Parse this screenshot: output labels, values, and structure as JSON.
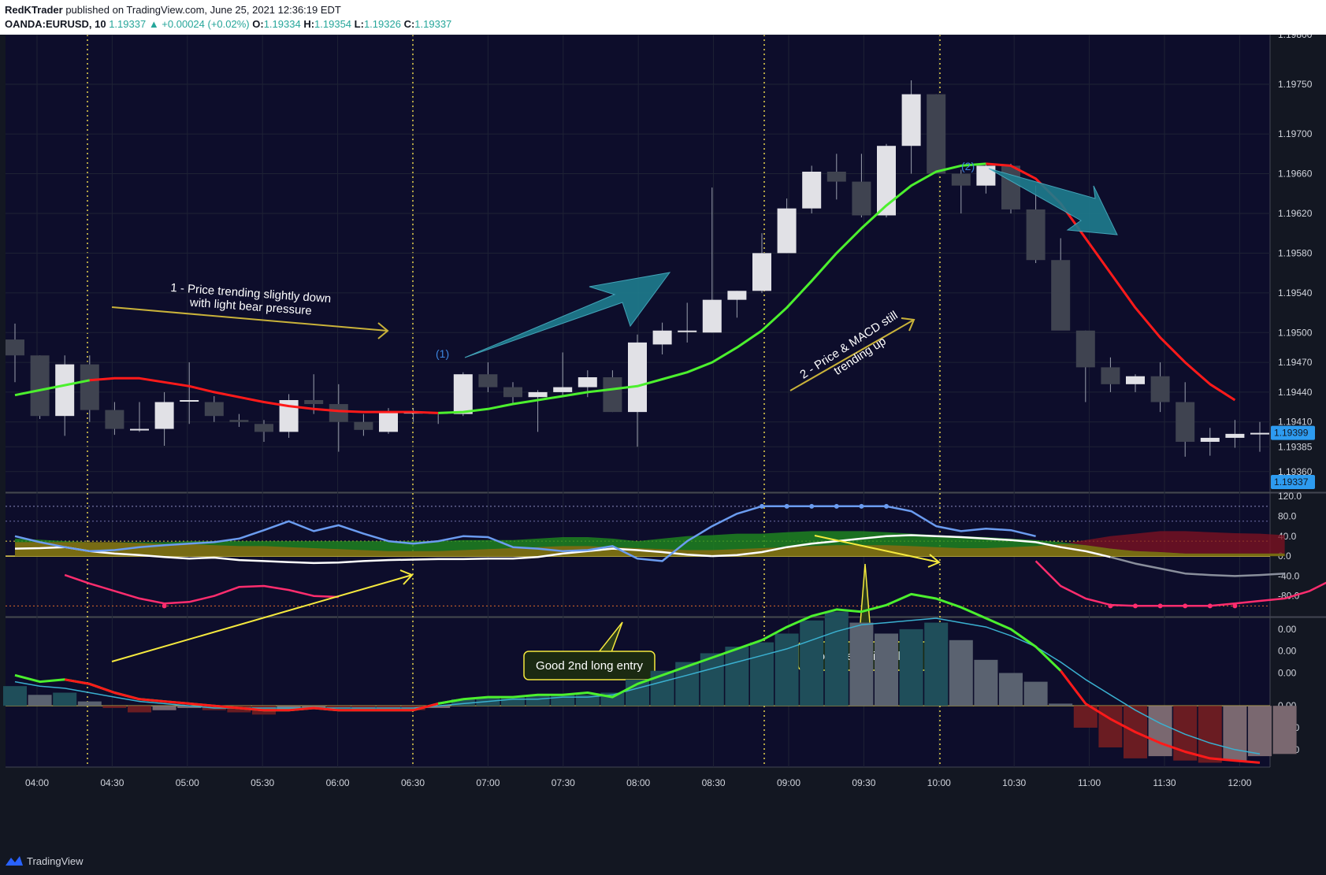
{
  "header": {
    "author": "RedKTrader",
    "published_text": " published on TradingView.com, June 25, 2021 12:36:19 EDT",
    "symbol": "OANDA:EURUSD, 10",
    "last": "1.19337",
    "change": "▲ +0.00024 (+0.02%)",
    "o_label": "O:",
    "o_val": "1.19334",
    "h_label": "H:",
    "h_val": "1.19354",
    "l_label": "L:",
    "l_val": "1.19326",
    "c_label": "C:",
    "c_val": "1.19337"
  },
  "footer": {
    "brand": "TradingView",
    "logo_icon": "tradingview-logo-icon"
  },
  "colors": {
    "background": "#131722",
    "panel_bg": "#0d0d2b",
    "up_candle": "#e1e1e6",
    "down_candle": "#3f4350",
    "ma_up": "#4cf02e",
    "ma_down": "#ff1a1a",
    "macd_blue": "#6b9cf0",
    "macd_pink": "#ff2d6e",
    "macd_white": "#ffffff",
    "annot_yellow": "#f5e93e",
    "arrow_teal": "#1e7c8e",
    "price_badge": "#2d9bf0"
  },
  "chart_data": [
    {
      "type": "candlestick",
      "panel": "price",
      "x_ticks": [
        "04:00",
        "04:30",
        "05:00",
        "05:30",
        "06:00",
        "06:30",
        "07:00",
        "07:30",
        "08:00",
        "08:30",
        "09:00",
        "09:30",
        "10:00",
        "10:30",
        "11:00",
        "11:30",
        "12:00"
      ],
      "y_ticks": [
        "1.19800",
        "1.19750",
        "1.19700",
        "1.19660",
        "1.19620",
        "1.19580",
        "1.19540",
        "1.19500",
        "1.19470",
        "1.19440",
        "1.19410",
        "1.19385",
        "1.19360"
      ],
      "ylim": [
        1.1934,
        1.198
      ],
      "price_badges": [
        "1.19399",
        "1.19337"
      ],
      "candles": [
        {
          "o": 1.19493,
          "h": 1.19509,
          "l": 1.1945,
          "c": 1.19477
        },
        {
          "o": 1.19477,
          "h": 1.19477,
          "l": 1.19413,
          "c": 1.19416
        },
        {
          "o": 1.19416,
          "h": 1.19477,
          "l": 1.19396,
          "c": 1.19468
        },
        {
          "o": 1.19468,
          "h": 1.19477,
          "l": 1.1941,
          "c": 1.19422
        },
        {
          "o": 1.19422,
          "h": 1.1943,
          "l": 1.19397,
          "c": 1.19403
        },
        {
          "o": 1.19403,
          "h": 1.1943,
          "l": 1.194,
          "c": 1.19403
        },
        {
          "o": 1.19403,
          "h": 1.1944,
          "l": 1.19386,
          "c": 1.1943
        },
        {
          "o": 1.19432,
          "h": 1.1947,
          "l": 1.19408,
          "c": 1.19432
        },
        {
          "o": 1.1943,
          "h": 1.19436,
          "l": 1.1941,
          "c": 1.19416
        },
        {
          "o": 1.19412,
          "h": 1.19418,
          "l": 1.19405,
          "c": 1.1941
        },
        {
          "o": 1.19408,
          "h": 1.19412,
          "l": 1.1939,
          "c": 1.194
        },
        {
          "o": 1.194,
          "h": 1.19438,
          "l": 1.19394,
          "c": 1.19432
        },
        {
          "o": 1.19432,
          "h": 1.19458,
          "l": 1.19418,
          "c": 1.19428
        },
        {
          "o": 1.19428,
          "h": 1.19448,
          "l": 1.1938,
          "c": 1.1941
        },
        {
          "o": 1.1941,
          "h": 1.19418,
          "l": 1.19396,
          "c": 1.19402
        },
        {
          "o": 1.194,
          "h": 1.19424,
          "l": 1.19398,
          "c": 1.1942
        },
        {
          "o": 1.1942,
          "h": 1.19424,
          "l": 1.1941,
          "c": 1.1942
        },
        {
          "o": 1.1942,
          "h": 1.1942,
          "l": 1.19408,
          "c": 1.19418
        },
        {
          "o": 1.19418,
          "h": 1.1946,
          "l": 1.19416,
          "c": 1.19458
        },
        {
          "o": 1.19458,
          "h": 1.1947,
          "l": 1.1944,
          "c": 1.19445
        },
        {
          "o": 1.19445,
          "h": 1.1945,
          "l": 1.19428,
          "c": 1.19435
        },
        {
          "o": 1.19435,
          "h": 1.19442,
          "l": 1.194,
          "c": 1.1944
        },
        {
          "o": 1.1944,
          "h": 1.1948,
          "l": 1.19435,
          "c": 1.19445
        },
        {
          "o": 1.19445,
          "h": 1.19462,
          "l": 1.19435,
          "c": 1.19455
        },
        {
          "o": 1.19455,
          "h": 1.19462,
          "l": 1.1942,
          "c": 1.1942
        },
        {
          "o": 1.1942,
          "h": 1.19498,
          "l": 1.19385,
          "c": 1.1949
        },
        {
          "o": 1.19488,
          "h": 1.1951,
          "l": 1.19478,
          "c": 1.19502
        },
        {
          "o": 1.19502,
          "h": 1.1953,
          "l": 1.1949,
          "c": 1.19502
        },
        {
          "o": 1.195,
          "h": 1.19646,
          "l": 1.195,
          "c": 1.19533
        },
        {
          "o": 1.19533,
          "h": 1.19542,
          "l": 1.19515,
          "c": 1.19542
        },
        {
          "o": 1.19542,
          "h": 1.196,
          "l": 1.1954,
          "c": 1.1958
        },
        {
          "o": 1.1958,
          "h": 1.19635,
          "l": 1.1958,
          "c": 1.19625
        },
        {
          "o": 1.19625,
          "h": 1.19668,
          "l": 1.1962,
          "c": 1.19662
        },
        {
          "o": 1.19662,
          "h": 1.1968,
          "l": 1.19634,
          "c": 1.19652
        },
        {
          "o": 1.19652,
          "h": 1.1968,
          "l": 1.19616,
          "c": 1.19618
        },
        {
          "o": 1.19618,
          "h": 1.1969,
          "l": 1.19616,
          "c": 1.19688
        },
        {
          "o": 1.19688,
          "h": 1.19754,
          "l": 1.1966,
          "c": 1.1974
        },
        {
          "o": 1.1974,
          "h": 1.1974,
          "l": 1.1966,
          "c": 1.1966
        },
        {
          "o": 1.1966,
          "h": 1.19664,
          "l": 1.1962,
          "c": 1.19648
        },
        {
          "o": 1.19648,
          "h": 1.1967,
          "l": 1.1964,
          "c": 1.19668
        },
        {
          "o": 1.19668,
          "h": 1.1967,
          "l": 1.1962,
          "c": 1.19624
        },
        {
          "o": 1.19624,
          "h": 1.19648,
          "l": 1.1957,
          "c": 1.19573
        },
        {
          "o": 1.19573,
          "h": 1.19595,
          "l": 1.1951,
          "c": 1.19502
        },
        {
          "o": 1.19502,
          "h": 1.19502,
          "l": 1.1943,
          "c": 1.19465
        },
        {
          "o": 1.19465,
          "h": 1.19475,
          "l": 1.1944,
          "c": 1.19448
        },
        {
          "o": 1.19448,
          "h": 1.19458,
          "l": 1.1944,
          "c": 1.19456
        },
        {
          "o": 1.19456,
          "h": 1.1947,
          "l": 1.1942,
          "c": 1.1943
        },
        {
          "o": 1.1943,
          "h": 1.1945,
          "l": 1.19375,
          "c": 1.1939
        },
        {
          "o": 1.1939,
          "h": 1.19404,
          "l": 1.19376,
          "c": 1.19394
        },
        {
          "o": 1.19394,
          "h": 1.19412,
          "l": 1.19384,
          "c": 1.19398
        },
        {
          "o": 1.19398,
          "h": 1.1941,
          "l": 1.1938,
          "c": 1.19399
        }
      ],
      "ma": [
        1.19437,
        1.19442,
        1.19447,
        1.19452,
        1.19454,
        1.19454,
        1.1945,
        1.19446,
        1.1944,
        1.19435,
        1.1943,
        1.19426,
        1.19423,
        1.19421,
        1.1942,
        1.1942,
        1.1942,
        1.19419,
        1.1942,
        1.19423,
        1.19428,
        1.19432,
        1.19436,
        1.1944,
        1.19443,
        1.19446,
        1.19453,
        1.1946,
        1.1947,
        1.19485,
        1.19502,
        1.19525,
        1.19552,
        1.1958,
        1.19605,
        1.19628,
        1.19648,
        1.19662,
        1.19668,
        1.1967,
        1.19668,
        1.19655,
        1.1963,
        1.19595,
        1.1956,
        1.19525,
        1.19495,
        1.1947,
        1.19448,
        1.19432
      ],
      "ma_up_until_index": 39,
      "annotations": [
        {
          "text_lines": [
            "1 - Price trending slightly down",
            "with light bear pressure"
          ]
        },
        {
          "text": "(1)"
        },
        {
          "text": "(2)"
        },
        {
          "text_lines": [
            "2 - Price & MACD still",
            "trending up"
          ]
        }
      ]
    },
    {
      "type": "line",
      "panel": "oscillator",
      "y_ticks": [
        "120.0",
        "80.0",
        "40.0",
        "0.0",
        "-40.0",
        "-80.0"
      ],
      "ylim": [
        -120,
        125
      ],
      "blue": [
        40,
        28,
        18,
        10,
        12,
        18,
        22,
        25,
        28,
        35,
        52,
        70,
        50,
        62,
        45,
        30,
        25,
        30,
        40,
        38,
        18,
        15,
        10,
        12,
        20,
        -5,
        -10,
        30,
        60,
        85,
        100,
        100,
        100,
        100,
        100,
        100,
        90,
        60,
        50,
        55,
        52,
        40,
        null,
        null,
        null,
        null,
        null,
        null,
        null,
        null,
        null
      ],
      "pink": [
        null,
        null,
        -38,
        -55,
        -70,
        -85,
        -95,
        -92,
        -80,
        -62,
        -60,
        -68,
        -80,
        -82,
        null,
        null,
        null,
        null,
        null,
        null,
        null,
        null,
        null,
        null,
        null,
        null,
        null,
        null,
        null,
        null,
        null,
        null,
        null,
        null,
        null,
        null,
        null,
        null,
        null,
        null,
        null,
        -10,
        -60,
        -85,
        -98,
        -100,
        -100,
        -100,
        -100,
        -95,
        -90,
        -85,
        -70,
        -45,
        -25
      ],
      "white": [
        15,
        16,
        18,
        10,
        5,
        2,
        -2,
        -5,
        -3,
        -8,
        -10,
        -12,
        -14,
        -13,
        -10,
        -8,
        -7,
        -6,
        -6,
        -5,
        -5,
        -2,
        5,
        10,
        15,
        12,
        8,
        3,
        0,
        2,
        8,
        18,
        25,
        30,
        35,
        40,
        42,
        40,
        38,
        35,
        32,
        28,
        18,
        10,
        -2,
        -15,
        -25,
        -35,
        -38,
        -40,
        -38,
        -35
      ],
      "band_green": [
        35,
        33,
        30,
        28,
        28,
        28,
        28,
        30,
        30,
        30,
        30,
        30,
        30,
        30,
        30,
        30,
        30,
        30,
        32,
        32,
        32,
        35,
        38,
        38,
        35,
        30,
        35,
        40,
        42,
        45,
        45,
        48,
        50,
        50,
        50,
        48,
        45,
        42,
        40,
        38,
        35,
        32,
        28,
        22,
        15,
        10,
        8,
        5,
        5,
        5,
        5,
        5
      ],
      "band_red": [
        28,
        28,
        28,
        28,
        28,
        26,
        24,
        24,
        22,
        20,
        20,
        18,
        16,
        14,
        12,
        10,
        10,
        10,
        12,
        14,
        16,
        18,
        20,
        20,
        18,
        16,
        14,
        12,
        12,
        14,
        16,
        18,
        20,
        22,
        22,
        22,
        20,
        18,
        16,
        16,
        18,
        20,
        24,
        32,
        40,
        45,
        50,
        50,
        48,
        46,
        45,
        42
      ],
      "annotations": [
        {
          "text": "Good 2nd long entry"
        },
        {
          "text": "Consider exiting long"
        }
      ]
    },
    {
      "type": "bar",
      "panel": "macd_histogram",
      "y_ticks": [
        "0.00",
        "0.00",
        "0.00",
        "0.00",
        "-0.00",
        "-0.00"
      ],
      "ylim": [
        -0.00028,
        0.0004
      ],
      "hist": [
        9e-05,
        5e-05,
        6e-05,
        2e-05,
        -1e-05,
        -3e-05,
        -2e-05,
        -1e-05,
        -2e-05,
        -3e-05,
        -4e-05,
        -2e-05,
        -1e-05,
        -1e-05,
        -2e-05,
        -2e-05,
        -2e-05,
        -1e-05,
        3e-05,
        4e-05,
        4e-05,
        5e-05,
        5e-05,
        5e-05,
        6e-05,
        0.00012,
        0.00016,
        0.0002,
        0.00024,
        0.00027,
        0.00029,
        0.00033,
        0.00039,
        0.00043,
        0.00038,
        0.00033,
        0.00035,
        0.00038,
        0.0003,
        0.00021,
        0.00015,
        0.00011,
        1e-05,
        -0.0001,
        -0.00019,
        -0.00024,
        -0.00023,
        -0.00025,
        -0.00026,
        -0.00025,
        -0.00023,
        -0.00022
      ],
      "signal": [
        0.00011,
        9e-05,
        8e-05,
        6e-05,
        4e-05,
        2e-05,
        1e-05,
        0.0,
        -1e-05,
        -1e-05,
        -1e-05,
        -1e-05,
        -1e-05,
        -1e-05,
        -1e-05,
        -1e-05,
        -1e-05,
        0.0,
        1e-05,
        2e-05,
        3e-05,
        3e-05,
        4e-05,
        4e-05,
        5e-05,
        8e-05,
        0.00011,
        0.00014,
        0.00017,
        0.0002,
        0.00023,
        0.00026,
        0.0003,
        0.00034,
        0.00037,
        0.00038,
        0.00039,
        0.0004,
        0.00038,
        0.00036,
        0.00032,
        0.00027,
        0.0002,
        0.00012,
        5e-05,
        -2e-05,
        -8e-05,
        -0.00013,
        -0.00017,
        -0.0002,
        -0.00022
      ],
      "macd": [
        0.00014,
        0.00011,
        0.00012,
        0.0001,
        6e-05,
        3e-05,
        2e-05,
        1e-05,
        0.0,
        -1e-05,
        -2e-05,
        -2e-05,
        -1e-05,
        -2e-05,
        -2e-05,
        -2e-05,
        -2e-05,
        1e-05,
        3e-05,
        4e-05,
        4e-05,
        5e-05,
        5e-05,
        6e-05,
        4e-05,
        0.0001,
        0.00014,
        0.00018,
        0.00022,
        0.00026,
        0.0003,
        0.00036,
        0.00041,
        0.00044,
        0.00043,
        0.00046,
        0.00051,
        0.00049,
        0.00045,
        0.0004,
        0.00035,
        0.00027,
        0.00016,
        1e-05,
        -6e-05,
        -0.00012,
        -0.00017,
        -0.00021,
        -0.00024,
        -0.00025,
        -0.00026
      ]
    }
  ]
}
